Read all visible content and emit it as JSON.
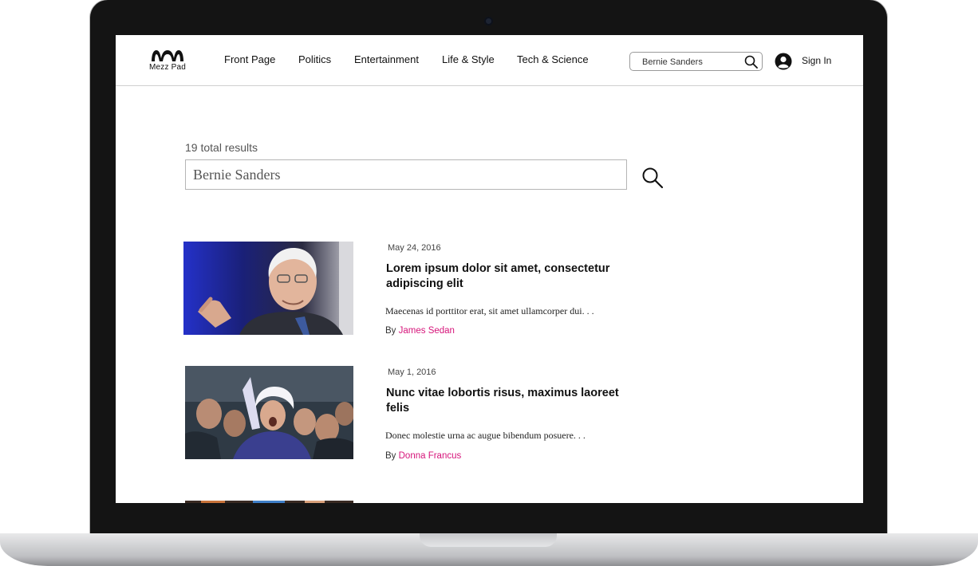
{
  "site": {
    "logo_text": "Mezz Pad"
  },
  "nav": [
    "Front Page",
    "Politics",
    "Entertainment",
    "Life & Style",
    "Tech & Science"
  ],
  "header_search": {
    "value": "Bernie Sanders"
  },
  "account": {
    "sign_in_label": "Sign In"
  },
  "results": {
    "count_text": "19 total results",
    "query": "Bernie Sanders",
    "articles": [
      {
        "date": "May 24, 2016",
        "title": "Lorem ipsum dolor sit amet, consectetur adipiscing elit",
        "excerpt": "Maecenas id porttitor erat, sit amet ullamcorper dui. . .",
        "by_prefix": "By",
        "author": "James Sedan"
      },
      {
        "date": "May 1, 2016",
        "title": "Nunc vitae lobortis risus, maximus laoreet felis",
        "excerpt": "Donec molestie urna ac augue bibendum posuere. . .",
        "by_prefix": "By",
        "author": "Donna Francus"
      }
    ]
  },
  "colors": {
    "author_link": "#d6147a",
    "bezel": "#141414"
  }
}
